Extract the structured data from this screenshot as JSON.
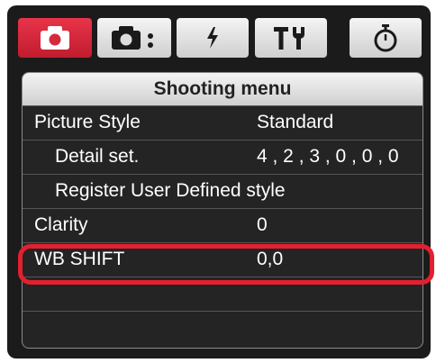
{
  "tabs": [
    {
      "icon": "camera-icon",
      "active": true
    },
    {
      "icon": "camera-dots-icon",
      "active": false
    },
    {
      "icon": "flash-icon",
      "active": false
    },
    {
      "icon": "custom-functions-icon",
      "active": false
    },
    {
      "icon": "timer-icon",
      "active": false
    }
  ],
  "menu": {
    "title": "Shooting menu",
    "rows": [
      {
        "label": "Picture Style",
        "value": "Standard"
      },
      {
        "label": "Detail set.",
        "value": "4 , 2 , 3 , 0 , 0 , 0"
      },
      {
        "label": "Register User Defined style",
        "value": ""
      },
      {
        "label": "Clarity",
        "value": "0"
      },
      {
        "label": "WB SHIFT",
        "value": "0,0"
      }
    ]
  },
  "colors": {
    "active_tab": "#d42a3d",
    "highlight": "#e3202f",
    "panel_bg": "#242424",
    "frame_bg": "#1b1b1b"
  }
}
